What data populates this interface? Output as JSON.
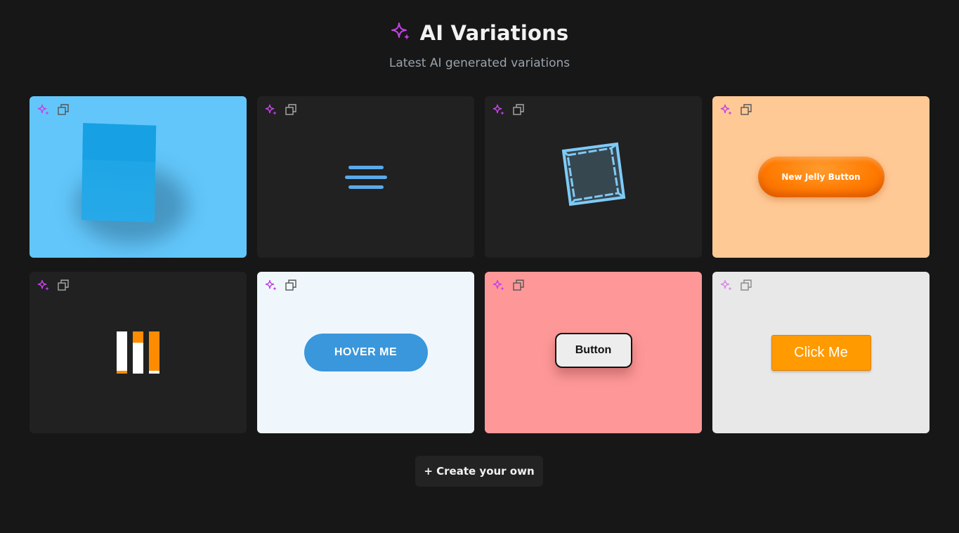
{
  "header": {
    "title": "AI Variations",
    "subtitle": "Latest AI generated variations"
  },
  "colors": {
    "page_bg": "#171717",
    "card_dark": "#212121",
    "sparkle": "#c542e8",
    "accent_blue": "#60c5f9",
    "accent_orange": "#ff8c00"
  },
  "cards": [
    {
      "bg": "#62c6fa",
      "preview": "3d-cube",
      "tools": [
        "sparkle-icon",
        "copy-icon"
      ]
    },
    {
      "bg": "#212121",
      "preview": "hamburger-menu",
      "tools": [
        "sparkle-icon",
        "copy-icon"
      ]
    },
    {
      "bg": "#212121",
      "preview": "wireframe-cube",
      "tools": [
        "sparkle-icon",
        "copy-icon"
      ]
    },
    {
      "bg": "#ffc995",
      "preview": "jelly-button",
      "label": "New Jelly Button",
      "tools": [
        "sparkle-icon",
        "copy-icon"
      ]
    },
    {
      "bg": "#212121",
      "preview": "loading-bars",
      "tools": [
        "sparkle-icon",
        "copy-icon"
      ]
    },
    {
      "bg": "#eff7fd",
      "preview": "hover-button",
      "label": "HOVER ME",
      "tools": [
        "sparkle-icon",
        "copy-icon"
      ]
    },
    {
      "bg": "#fe9898",
      "preview": "button",
      "label": "Button",
      "tools": [
        "sparkle-icon",
        "copy-icon"
      ]
    },
    {
      "bg": "#e8e8e8",
      "preview": "click-button",
      "label": "Click Me",
      "tools": [
        "sparkle-icon",
        "copy-icon"
      ]
    }
  ],
  "create_button_label": "+ Create your own"
}
